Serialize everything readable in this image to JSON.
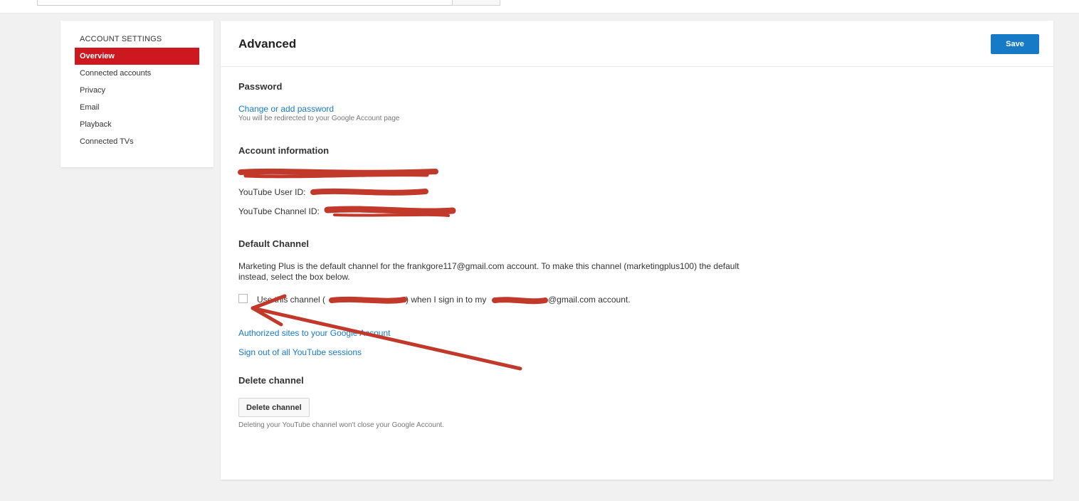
{
  "search": {
    "placeholder": ""
  },
  "sidebar": {
    "heading": "ACCOUNT SETTINGS",
    "items": [
      {
        "label": "Overview",
        "active": true
      },
      {
        "label": "Connected accounts"
      },
      {
        "label": "Privacy"
      },
      {
        "label": "Email"
      },
      {
        "label": "Playback"
      },
      {
        "label": "Connected TVs"
      }
    ]
  },
  "main": {
    "title": "Advanced",
    "save_label": "Save",
    "password": {
      "title": "Password",
      "link": "Change or add password",
      "hint": "You will be redirected to your Google Account page"
    },
    "account_info": {
      "title": "Account information",
      "user_id_label": "YouTube User ID:",
      "channel_id_label": "YouTube Channel ID:"
    },
    "default_channel": {
      "title": "Default Channel",
      "description": "Marketing Plus is the default channel for the frankgore117@gmail.com account. To make this channel (marketingplus100) the default instead, select the box below.",
      "checkbox_text_start": "Use this channel (",
      "checkbox_text_mid": ") when I sign in to my",
      "checkbox_text_end": "@gmail.com account."
    },
    "links": {
      "authorized_sites": "Authorized sites to your Google Account",
      "sign_out": "Sign out of all YouTube sessions"
    },
    "delete": {
      "title": "Delete channel",
      "button": "Delete channel",
      "hint": "Deleting your YouTube channel won't close your Google Account."
    }
  },
  "colors": {
    "accent_red": "#cc181e",
    "primary_blue": "#167ac6",
    "redaction": "#c0392b"
  }
}
